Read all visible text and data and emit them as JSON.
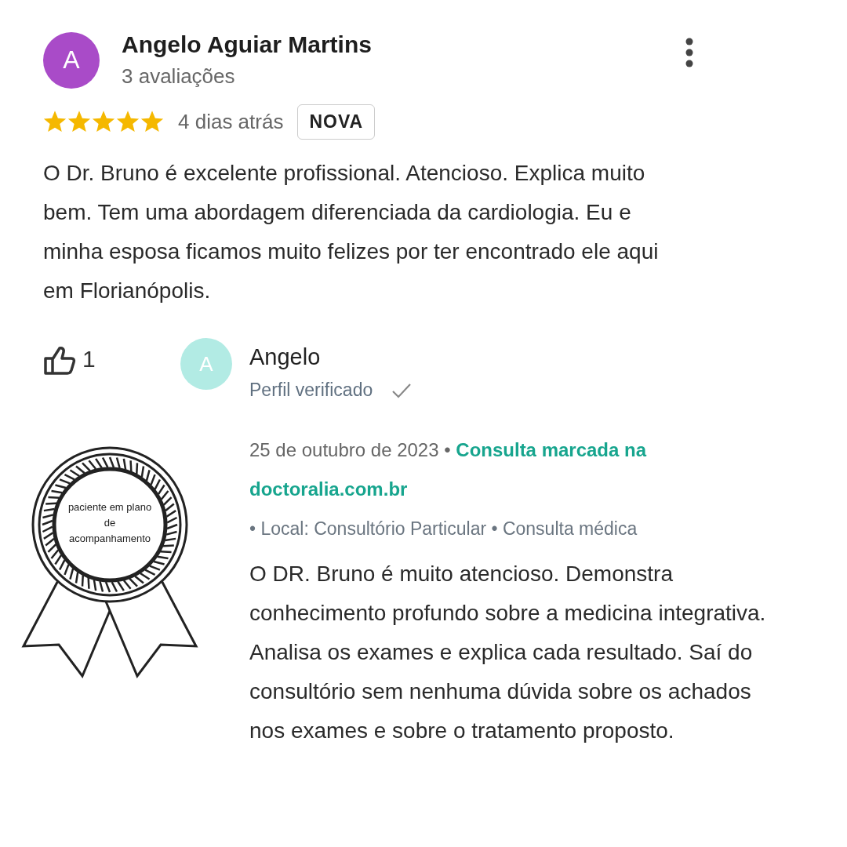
{
  "review": {
    "avatar_letter": "A",
    "author": "Angelo Aguiar Martins",
    "review_count": "3 avaliações",
    "stars": 5,
    "time": "4 dias atrás",
    "badge": "NOVA",
    "text": "O Dr. Bruno é excelente profissional. Atencioso. Explica muito bem. Tem uma abordagem diferenciada da cardiologia. Eu e minha esposa ficamos muito felizes por ter encontrado ele aqui em Florianópolis."
  },
  "likes": "1",
  "seal": {
    "text": "paciente em plano de acompanhamento"
  },
  "reply": {
    "avatar_letter": "A",
    "author": "Angelo",
    "verified": "Perfil verificado",
    "date": "25 de outubro de 2023",
    "separator": "•",
    "source": "Consulta marcada na doctoralia.com.br",
    "details": "• Local: Consultório Particular • Consulta médica",
    "text": "O DR. Bruno é muito atencioso. Demonstra conhecimento profundo sobre a medicina integrativa. Analisa os exames e explica cada resultado. Saí do consultório sem nenhuma dúvida sobre os achados nos exames e sobre o tratamento proposto."
  }
}
